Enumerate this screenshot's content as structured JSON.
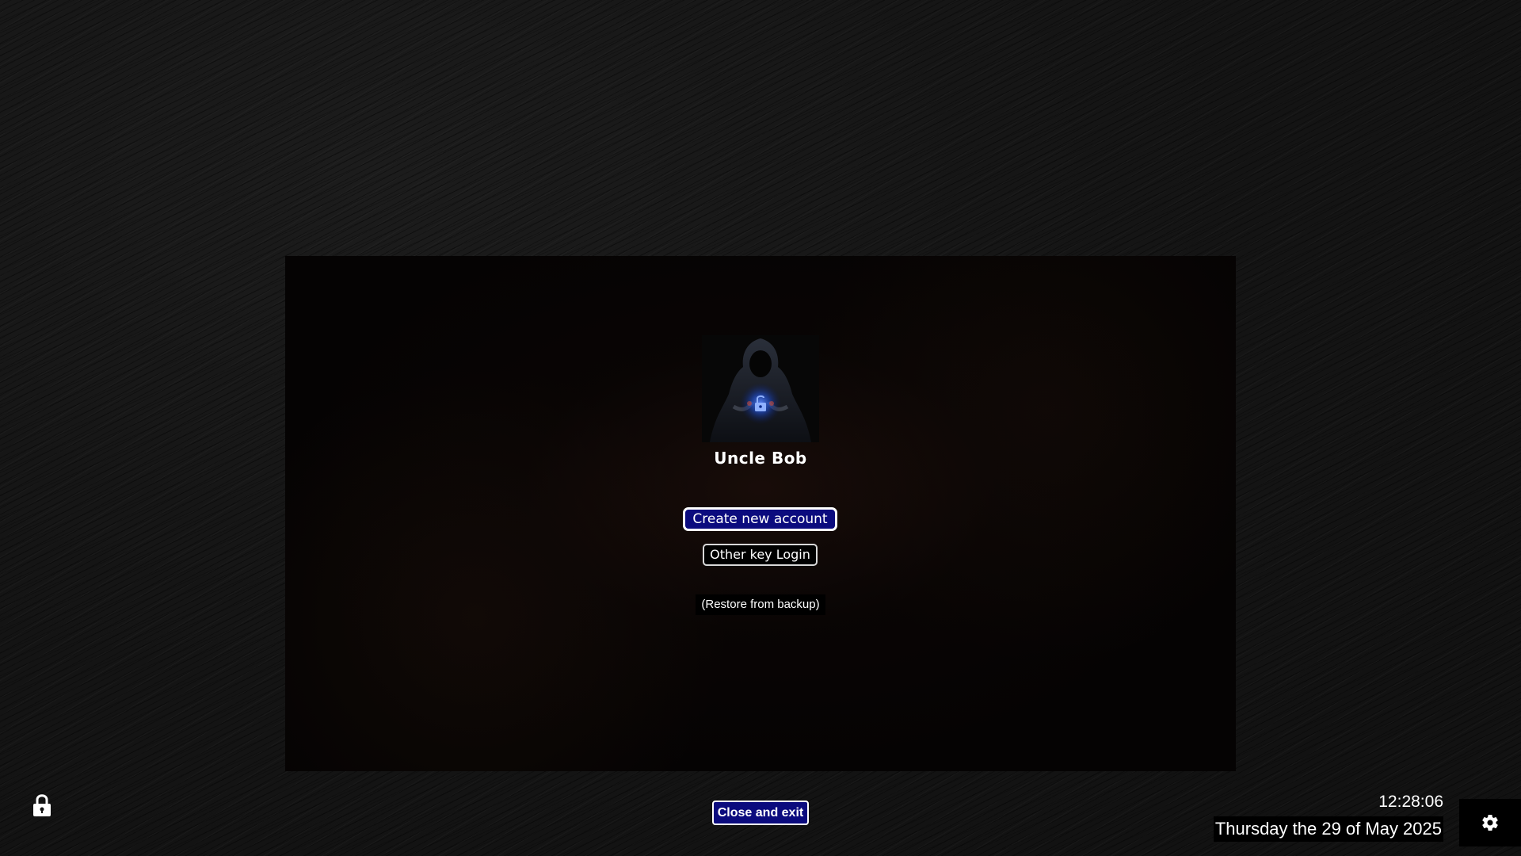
{
  "login": {
    "username": "Uncle Bob",
    "create_account_label": "Create new account",
    "other_key_login_label": "Other key Login",
    "restore_backup_label": "(Restore from backup)"
  },
  "footer": {
    "close_exit_label": "Close and exit",
    "time": "12:28:06",
    "date": "Thursday the 29 of May 2025"
  },
  "icons": {
    "lock": "lock-icon",
    "settings": "gear-icon",
    "avatar": "hooded-figure-unlock-avatar"
  },
  "colors": {
    "primary_button": "#0b0b7e",
    "avatar_glow": "#2f6bff"
  }
}
